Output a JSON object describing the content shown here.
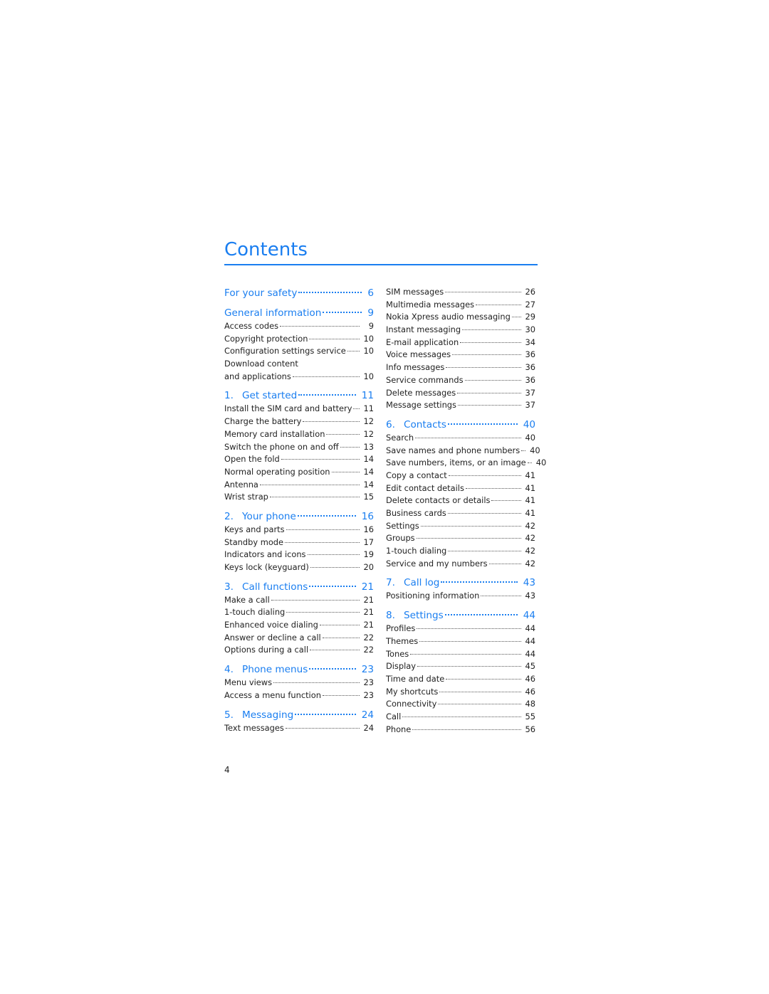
{
  "title": "Contents",
  "page_number": "4",
  "left_column": [
    {
      "type": "head",
      "num": "",
      "label": "For your safety",
      "page": "6"
    },
    {
      "type": "head",
      "num": "",
      "label": "General information",
      "page": "9"
    },
    {
      "type": "row",
      "label": "Access codes",
      "page": "9"
    },
    {
      "type": "row",
      "label": "Copyright protection",
      "page": "10"
    },
    {
      "type": "row",
      "label": "Configuration settings service",
      "page": "10"
    },
    {
      "type": "cont",
      "label": "Download content",
      "page": ""
    },
    {
      "type": "row",
      "label": "and applications",
      "page": "10"
    },
    {
      "type": "head",
      "num": "1.",
      "label": "Get started",
      "page": "11"
    },
    {
      "type": "row",
      "label": "Install the SIM card and battery",
      "page": "11"
    },
    {
      "type": "row",
      "label": "Charge the battery",
      "page": "12"
    },
    {
      "type": "row",
      "label": "Memory card installation",
      "page": "12"
    },
    {
      "type": "row",
      "label": "Switch the phone on and off",
      "page": "13"
    },
    {
      "type": "row",
      "label": "Open the fold",
      "page": "14"
    },
    {
      "type": "row",
      "label": "Normal operating position",
      "page": "14"
    },
    {
      "type": "row",
      "label": "Antenna",
      "page": "14"
    },
    {
      "type": "row",
      "label": "Wrist strap",
      "page": "15"
    },
    {
      "type": "head",
      "num": "2.",
      "label": "Your phone",
      "page": "16"
    },
    {
      "type": "row",
      "label": "Keys and parts",
      "page": "16"
    },
    {
      "type": "row",
      "label": "Standby mode",
      "page": "17"
    },
    {
      "type": "row",
      "label": "Indicators and icons",
      "page": "19"
    },
    {
      "type": "row",
      "label": "Keys lock (keyguard)",
      "page": "20"
    },
    {
      "type": "head",
      "num": "3.",
      "label": "Call functions",
      "page": "21"
    },
    {
      "type": "row",
      "label": "Make a call",
      "page": "21"
    },
    {
      "type": "row",
      "label": "1-touch dialing",
      "page": "21"
    },
    {
      "type": "row",
      "label": "Enhanced voice dialing",
      "page": "21"
    },
    {
      "type": "row",
      "label": "Answer or decline a call",
      "page": "22"
    },
    {
      "type": "row",
      "label": "Options during a call",
      "page": "22"
    },
    {
      "type": "head",
      "num": "4.",
      "label": "Phone menus",
      "page": "23"
    },
    {
      "type": "row",
      "label": "Menu views",
      "page": "23"
    },
    {
      "type": "row",
      "label": "Access a menu function",
      "page": "23"
    },
    {
      "type": "head",
      "num": "5.",
      "label": "Messaging",
      "page": "24"
    },
    {
      "type": "row",
      "label": "Text messages",
      "page": "24"
    }
  ],
  "right_column": [
    {
      "type": "row",
      "label": "SIM messages",
      "page": "26"
    },
    {
      "type": "row",
      "label": "Multimedia messages",
      "page": "27"
    },
    {
      "type": "row",
      "label": "Nokia Xpress audio messaging",
      "page": "29"
    },
    {
      "type": "row",
      "label": "Instant messaging",
      "page": "30"
    },
    {
      "type": "row",
      "label": "E-mail application",
      "page": "34"
    },
    {
      "type": "row",
      "label": "Voice messages",
      "page": "36"
    },
    {
      "type": "row",
      "label": "Info messages",
      "page": "36"
    },
    {
      "type": "row",
      "label": "Service commands",
      "page": "36"
    },
    {
      "type": "row",
      "label": "Delete messages",
      "page": "37"
    },
    {
      "type": "row",
      "label": "Message settings",
      "page": "37"
    },
    {
      "type": "head",
      "num": "6.",
      "label": "Contacts",
      "page": "40"
    },
    {
      "type": "row",
      "label": "Search",
      "page": "40"
    },
    {
      "type": "row",
      "label": "Save names and phone numbers",
      "page": "40"
    },
    {
      "type": "row",
      "label": "Save numbers, items, or an image",
      "page": "40"
    },
    {
      "type": "row",
      "label": "Copy a contact",
      "page": "41"
    },
    {
      "type": "row",
      "label": "Edit contact details",
      "page": "41"
    },
    {
      "type": "row",
      "label": "Delete contacts or details",
      "page": "41"
    },
    {
      "type": "row",
      "label": "Business cards",
      "page": "41"
    },
    {
      "type": "row",
      "label": "Settings",
      "page": "42"
    },
    {
      "type": "row",
      "label": "Groups",
      "page": "42"
    },
    {
      "type": "row",
      "label": "1-touch dialing",
      "page": "42"
    },
    {
      "type": "row",
      "label": "Service and my numbers",
      "page": "42"
    },
    {
      "type": "head",
      "num": "7.",
      "label": "Call log",
      "page": "43"
    },
    {
      "type": "row",
      "label": "Positioning information",
      "page": "43"
    },
    {
      "type": "head",
      "num": "8.",
      "label": "Settings",
      "page": "44"
    },
    {
      "type": "row",
      "label": "Profiles",
      "page": "44"
    },
    {
      "type": "row",
      "label": "Themes",
      "page": "44"
    },
    {
      "type": "row",
      "label": "Tones",
      "page": "44"
    },
    {
      "type": "row",
      "label": "Display",
      "page": "45"
    },
    {
      "type": "row",
      "label": "Time and date",
      "page": "46"
    },
    {
      "type": "row",
      "label": "My shortcuts",
      "page": "46"
    },
    {
      "type": "row",
      "label": "Connectivity",
      "page": "48"
    },
    {
      "type": "row",
      "label": "Call",
      "page": "55"
    },
    {
      "type": "row",
      "label": "Phone",
      "page": "56"
    }
  ]
}
